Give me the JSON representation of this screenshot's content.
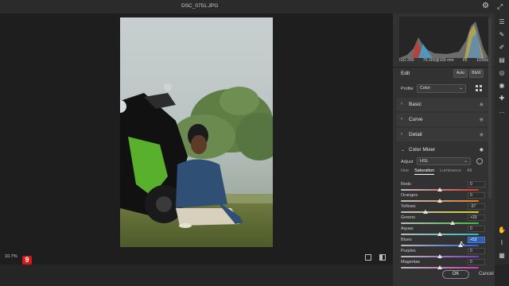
{
  "window": {
    "title": "DSC_0751.JPG"
  },
  "camera_info": {
    "iso": "ISO 200",
    "lens": "70-300@165 mm",
    "aperture": "f/5",
    "shutter": "1/250s"
  },
  "edit": {
    "title": "Edit",
    "auto_label": "Auto",
    "bw_label": "B&W"
  },
  "profile": {
    "label": "Profile",
    "value": "Color"
  },
  "sections": [
    {
      "label": "Basic"
    },
    {
      "label": "Curve"
    },
    {
      "label": "Detail"
    },
    {
      "label": "Color Mixer"
    }
  ],
  "color_mixer": {
    "adjust_label": "Adjust",
    "adjust_value": "HSL",
    "tabs": [
      "Hue",
      "Saturation",
      "Luminance",
      "All"
    ],
    "active_tab": "Saturation",
    "sliders": [
      {
        "label": "Reds",
        "value": "0",
        "level": 0,
        "color_left": "#bdbdbd",
        "color_right": "#d33c2b"
      },
      {
        "label": "Oranges",
        "value": "0",
        "level": 0,
        "color_left": "#bdbdbd",
        "color_right": "#e07b22"
      },
      {
        "label": "Yellows",
        "value": "-37",
        "level": -37,
        "color_left": "#bdbdbd",
        "color_right": "#d8cd2a"
      },
      {
        "label": "Greens",
        "value": "+33",
        "level": 33,
        "color_left": "#bdbdbd",
        "color_right": "#3fbb3a"
      },
      {
        "label": "Aquas",
        "value": "0",
        "level": 0,
        "color_left": "#bdbdbd",
        "color_right": "#2fbcbc"
      },
      {
        "label": "Blues",
        "value": "+53",
        "level": 53,
        "color_left": "#bdbdbd",
        "color_right": "#2c5fd6",
        "highlighted": true
      },
      {
        "label": "Purples",
        "value": "0",
        "level": 0,
        "color_left": "#bdbdbd",
        "color_right": "#7b3bc4"
      },
      {
        "label": "Magentas",
        "value": "0",
        "level": 0,
        "color_left": "#bdbdbd",
        "color_right": "#c93bb3"
      }
    ]
  },
  "footer": {
    "zoom": "10.7%",
    "ok_label": "OK",
    "cancel_label": "Cancel"
  },
  "icons": {
    "tools": [
      "sliders-icon",
      "brush-icon",
      "pencil-icon",
      "gradient-icon",
      "radial-icon",
      "eye-redeye-icon",
      "healing-icon",
      "more-icon",
      "hand-icon",
      "eyedropper-icon",
      "grid-icon"
    ]
  }
}
